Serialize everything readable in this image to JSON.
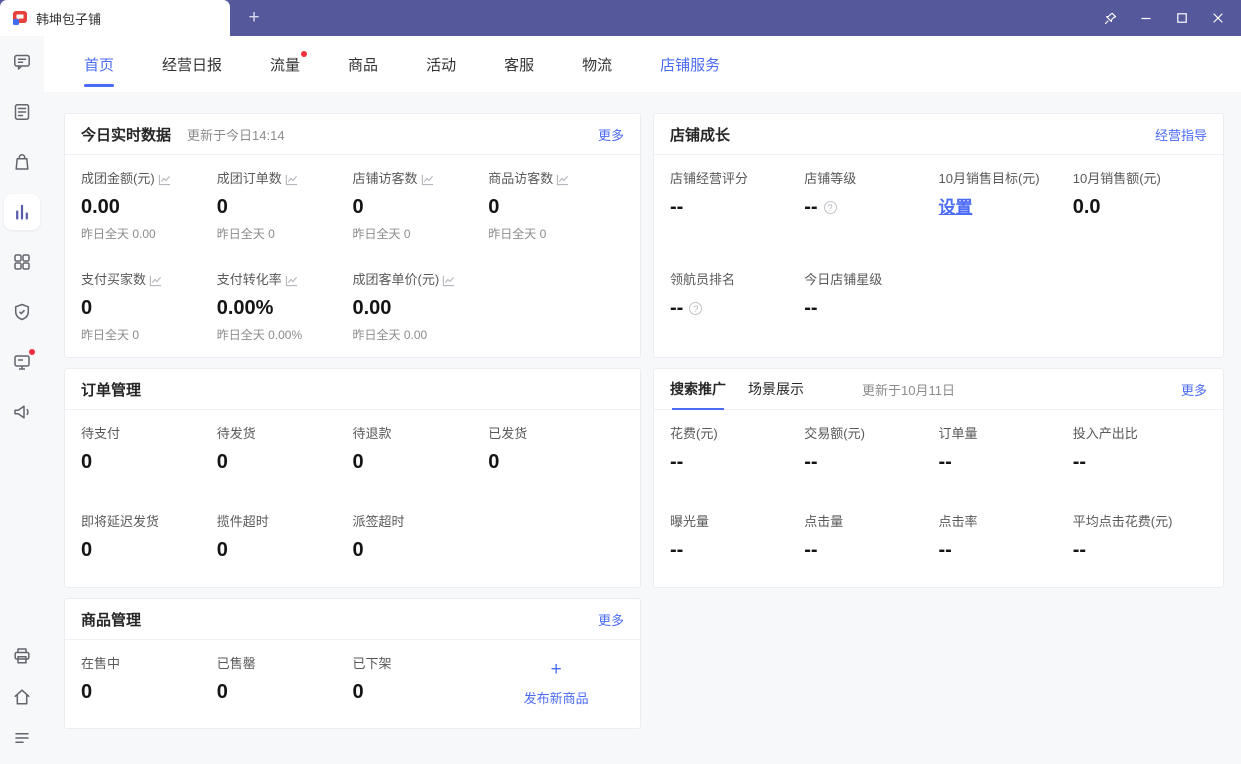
{
  "colors": {
    "titlebar": "#55589b",
    "accent": "#4c6bf5",
    "badge": "#f5313d",
    "content_bg": "#f7f8fa"
  },
  "window": {
    "tab_title": "韩坤包子铺",
    "new_tab_label": "+",
    "control_icons": [
      "pin-icon",
      "minimize-icon",
      "maximize-icon",
      "close-icon"
    ]
  },
  "sidebar": {
    "icons": [
      "chat-icon",
      "document-icon",
      "bag-icon",
      "bar-chart-icon",
      "grid-icon",
      "shield-icon",
      "billboard-icon",
      "megaphone-icon",
      "printer-icon",
      "home-icon",
      "menu-icon"
    ],
    "active": "bar-chart-icon"
  },
  "nav": {
    "tabs": [
      {
        "label": "首页",
        "active": true
      },
      {
        "label": "经营日报"
      },
      {
        "label": "流量",
        "badge": true
      },
      {
        "label": "商品"
      },
      {
        "label": "活动"
      },
      {
        "label": "客服"
      },
      {
        "label": "物流"
      },
      {
        "label": "店铺服务",
        "highlight": true
      }
    ]
  },
  "realtime": {
    "title": "今日实时数据",
    "updated": "更新于今日14:14",
    "more": "更多",
    "metrics": [
      {
        "label": "成团金额(元)",
        "value": "0.00",
        "sub": "昨日全天 0.00"
      },
      {
        "label": "成团订单数",
        "value": "0",
        "sub": "昨日全天 0"
      },
      {
        "label": "店铺访客数",
        "value": "0",
        "sub": "昨日全天 0"
      },
      {
        "label": "商品访客数",
        "value": "0",
        "sub": "昨日全天 0"
      },
      {
        "label": "支付买家数",
        "value": "0",
        "sub": "昨日全天 0"
      },
      {
        "label": "支付转化率",
        "value": "0.00%",
        "sub": "昨日全天 0.00%"
      },
      {
        "label": "成团客单价(元)",
        "value": "0.00",
        "sub": "昨日全天 0.00"
      }
    ]
  },
  "growth": {
    "title": "店铺成长",
    "guide_link": "经营指导",
    "metrics": [
      {
        "label": "店铺经营评分",
        "value": "--"
      },
      {
        "label": "店铺等级",
        "value": "--",
        "help": true
      },
      {
        "label": "10月销售目标(元)",
        "value": "设置",
        "is_link": true
      },
      {
        "label": "10月销售额(元)",
        "value": "0.0"
      },
      {
        "label": "领航员排名",
        "value": "--",
        "help": true
      },
      {
        "label": "今日店铺星级",
        "value": "--"
      }
    ]
  },
  "orders": {
    "title": "订单管理",
    "metrics": [
      {
        "label": "待支付",
        "value": "0"
      },
      {
        "label": "待发货",
        "value": "0"
      },
      {
        "label": "待退款",
        "value": "0"
      },
      {
        "label": "已发货",
        "value": "0"
      },
      {
        "label": "即将延迟发货",
        "value": "0"
      },
      {
        "label": "揽件超时",
        "value": "0"
      },
      {
        "label": "派签超时",
        "value": "0"
      }
    ]
  },
  "promotion": {
    "tabs": [
      {
        "label": "搜索推广",
        "active": true
      },
      {
        "label": "场景展示"
      }
    ],
    "updated": "更新于10月11日",
    "more": "更多",
    "metrics": [
      {
        "label": "花费(元)",
        "value": "--"
      },
      {
        "label": "交易额(元)",
        "value": "--"
      },
      {
        "label": "订单量",
        "value": "--"
      },
      {
        "label": "投入产出比",
        "value": "--"
      },
      {
        "label": "曝光量",
        "value": "--"
      },
      {
        "label": "点击量",
        "value": "--"
      },
      {
        "label": "点击率",
        "value": "--"
      },
      {
        "label": "平均点击花费(元)",
        "value": "--"
      }
    ]
  },
  "products": {
    "title": "商品管理",
    "more": "更多",
    "metrics": [
      {
        "label": "在售中",
        "value": "0"
      },
      {
        "label": "已售罄",
        "value": "0"
      },
      {
        "label": "已下架",
        "value": "0"
      }
    ],
    "action": {
      "plus": "+",
      "label": "发布新商品"
    }
  }
}
